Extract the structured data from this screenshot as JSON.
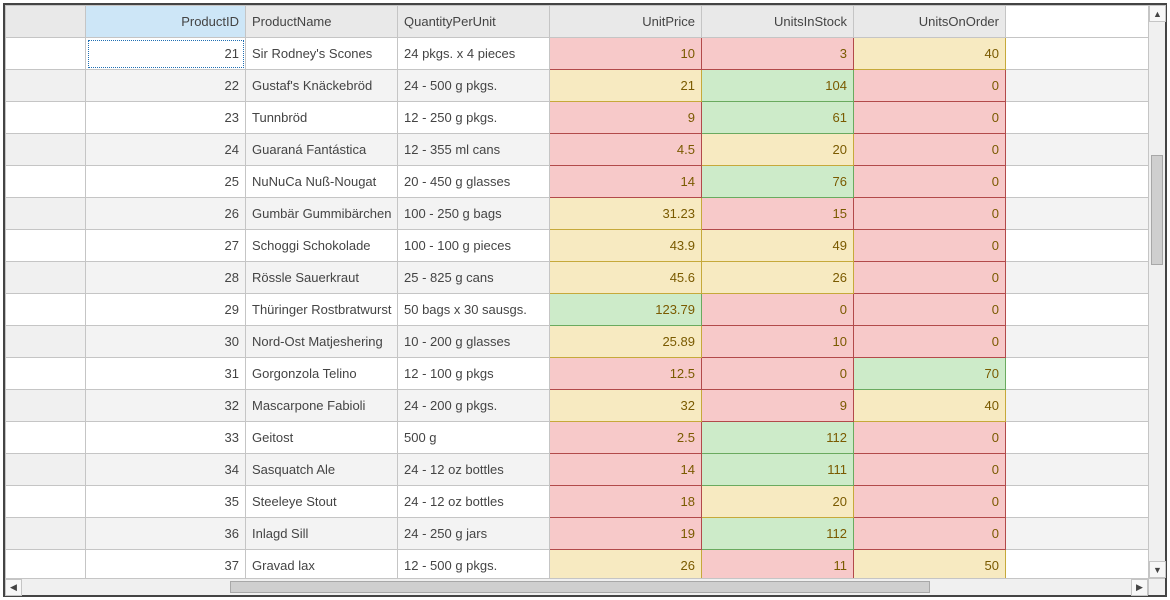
{
  "columns": {
    "productid": "ProductID",
    "productname": "ProductName",
    "qpu": "QuantityPerUnit",
    "unitprice": "UnitPrice",
    "stock": "UnitsInStock",
    "order": "UnitsOnOrder"
  },
  "rows": [
    {
      "id": 21,
      "name": "Sir Rodney's Scones",
      "qpu": "24 pkgs. x 4 pieces",
      "price": 10,
      "price_lv": "red",
      "stock": 3,
      "stock_lv": "red",
      "order": 40,
      "order_lv": "yel"
    },
    {
      "id": 22,
      "name": "Gustaf's Knäckebröd",
      "qpu": "24 - 500 g pkgs.",
      "price": 21,
      "price_lv": "yel",
      "stock": 104,
      "stock_lv": "grn",
      "order": 0,
      "order_lv": "red"
    },
    {
      "id": 23,
      "name": "Tunnbröd",
      "qpu": "12 - 250 g pkgs.",
      "price": 9,
      "price_lv": "red",
      "stock": 61,
      "stock_lv": "grn",
      "order": 0,
      "order_lv": "red"
    },
    {
      "id": 24,
      "name": "Guaraná Fantástica",
      "qpu": "12 - 355 ml cans",
      "price": 4.5,
      "price_lv": "red",
      "stock": 20,
      "stock_lv": "yel",
      "order": 0,
      "order_lv": "red"
    },
    {
      "id": 25,
      "name": "NuNuCa Nuß-Nougat",
      "qpu": "20 - 450 g glasses",
      "price": 14,
      "price_lv": "red",
      "stock": 76,
      "stock_lv": "grn",
      "order": 0,
      "order_lv": "red"
    },
    {
      "id": 26,
      "name": "Gumbär Gummibärchen",
      "qpu": "100 - 250 g bags",
      "price": 31.23,
      "price_lv": "yel",
      "stock": 15,
      "stock_lv": "red",
      "order": 0,
      "order_lv": "red"
    },
    {
      "id": 27,
      "name": "Schoggi Schokolade",
      "qpu": "100 - 100 g pieces",
      "price": 43.9,
      "price_lv": "yel",
      "stock": 49,
      "stock_lv": "yel",
      "order": 0,
      "order_lv": "red"
    },
    {
      "id": 28,
      "name": "Rössle Sauerkraut",
      "qpu": "25 - 825 g cans",
      "price": 45.6,
      "price_lv": "yel",
      "stock": 26,
      "stock_lv": "yel",
      "order": 0,
      "order_lv": "red"
    },
    {
      "id": 29,
      "name": "Thüringer Rostbratwurst",
      "qpu": "50 bags x 30 sausgs.",
      "price": 123.79,
      "price_lv": "grn",
      "stock": 0,
      "stock_lv": "red",
      "order": 0,
      "order_lv": "red"
    },
    {
      "id": 30,
      "name": "Nord-Ost Matjeshering",
      "qpu": "10 - 200 g glasses",
      "price": 25.89,
      "price_lv": "yel",
      "stock": 10,
      "stock_lv": "red",
      "order": 0,
      "order_lv": "red"
    },
    {
      "id": 31,
      "name": "Gorgonzola Telino",
      "qpu": "12 - 100 g pkgs",
      "price": 12.5,
      "price_lv": "red",
      "stock": 0,
      "stock_lv": "red",
      "order": 70,
      "order_lv": "grn"
    },
    {
      "id": 32,
      "name": "Mascarpone Fabioli",
      "qpu": "24 - 200 g pkgs.",
      "price": 32,
      "price_lv": "yel",
      "stock": 9,
      "stock_lv": "red",
      "order": 40,
      "order_lv": "yel"
    },
    {
      "id": 33,
      "name": "Geitost",
      "qpu": "500 g",
      "price": 2.5,
      "price_lv": "red",
      "stock": 112,
      "stock_lv": "grn",
      "order": 0,
      "order_lv": "red"
    },
    {
      "id": 34,
      "name": "Sasquatch Ale",
      "qpu": "24 - 12 oz bottles",
      "price": 14,
      "price_lv": "red",
      "stock": 111,
      "stock_lv": "grn",
      "order": 0,
      "order_lv": "red"
    },
    {
      "id": 35,
      "name": "Steeleye Stout",
      "qpu": "24 - 12 oz bottles",
      "price": 18,
      "price_lv": "red",
      "stock": 20,
      "stock_lv": "yel",
      "order": 0,
      "order_lv": "red"
    },
    {
      "id": 36,
      "name": "Inlagd Sill",
      "qpu": "24 - 250 g  jars",
      "price": 19,
      "price_lv": "red",
      "stock": 112,
      "stock_lv": "grn",
      "order": 0,
      "order_lv": "red"
    },
    {
      "id": 37,
      "name": "Gravad lax",
      "qpu": "12 - 500 g pkgs.",
      "price": 26,
      "price_lv": "yel",
      "stock": 11,
      "stock_lv": "red",
      "order": 50,
      "order_lv": "yel"
    }
  ],
  "selected_row_index": 0
}
